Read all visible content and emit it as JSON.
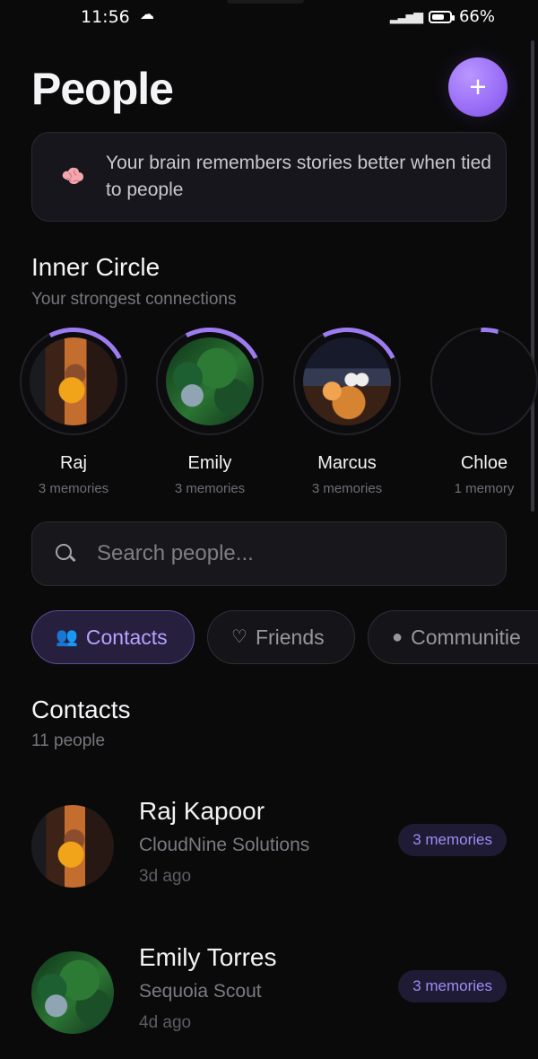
{
  "status_bar": {
    "time": "11:56",
    "battery": "66%"
  },
  "header": {
    "title": "People",
    "add_label": "+"
  },
  "tip": {
    "text": "Your brain remembers stories better when tied to people"
  },
  "inner_circle": {
    "title": "Inner Circle",
    "subtitle": "Your strongest connections",
    "people": [
      {
        "name": "Raj",
        "count": "3 memories",
        "progress": 0.18,
        "photo": "raj"
      },
      {
        "name": "Emily",
        "count": "3 memories",
        "progress": 0.18,
        "photo": "emily"
      },
      {
        "name": "Marcus",
        "count": "3 memories",
        "progress": 0.18,
        "photo": "marcus"
      },
      {
        "name": "Chloe",
        "count": "1 memory",
        "progress": 0.06,
        "photo": "chloe"
      }
    ]
  },
  "search": {
    "placeholder": "Search people..."
  },
  "filters": [
    {
      "label": "Contacts",
      "icon": "people-icon",
      "active": true
    },
    {
      "label": "Friends",
      "icon": "heart-icon",
      "active": false
    },
    {
      "label": "Communitie",
      "icon": "community-icon",
      "active": false
    }
  ],
  "contacts": {
    "title": "Contacts",
    "subtitle": "11 people",
    "items": [
      {
        "name": "Raj Kapoor",
        "company": "CloudNine Solutions",
        "time": "3d ago",
        "memories": "3 memories",
        "photo": "raj"
      },
      {
        "name": "Emily Torres",
        "company": "Sequoia Scout",
        "time": "4d ago",
        "memories": "3 memories",
        "photo": "emily"
      }
    ]
  },
  "colors": {
    "background": "#0a0a0b",
    "accent": "#9c7cf0",
    "accent_soft": "#261f3d",
    "card": "#17161c"
  }
}
